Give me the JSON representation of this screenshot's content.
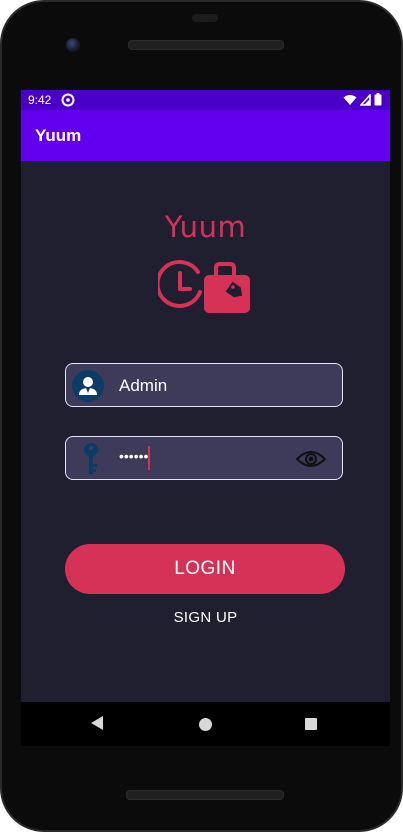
{
  "status_bar": {
    "time": "9:42",
    "icons": [
      "data-saver-icon",
      "wifi-icon",
      "signal-icon",
      "battery-icon"
    ]
  },
  "app_bar": {
    "title": "Yuum"
  },
  "logo": {
    "text": "Yuum",
    "icon": "clock-luggage-icon"
  },
  "login_form": {
    "username": {
      "value": "Admin",
      "icon": "user-avatar-icon"
    },
    "password": {
      "masked_value": "••••••",
      "icon": "key-icon",
      "toggle_icon": "eye-icon"
    },
    "login_label": "LOGIN",
    "signup_label": "SIGN UP"
  },
  "nav_bar": {
    "icons": [
      "back-icon",
      "home-icon",
      "recents-icon"
    ]
  },
  "colors": {
    "status_bar": "#4a00c8",
    "app_bar": "#6200ee",
    "background": "#1f1f2f",
    "accent": "#d63258",
    "field_bg": "#3d3a5a",
    "avatar_bg": "#0e3b66"
  }
}
